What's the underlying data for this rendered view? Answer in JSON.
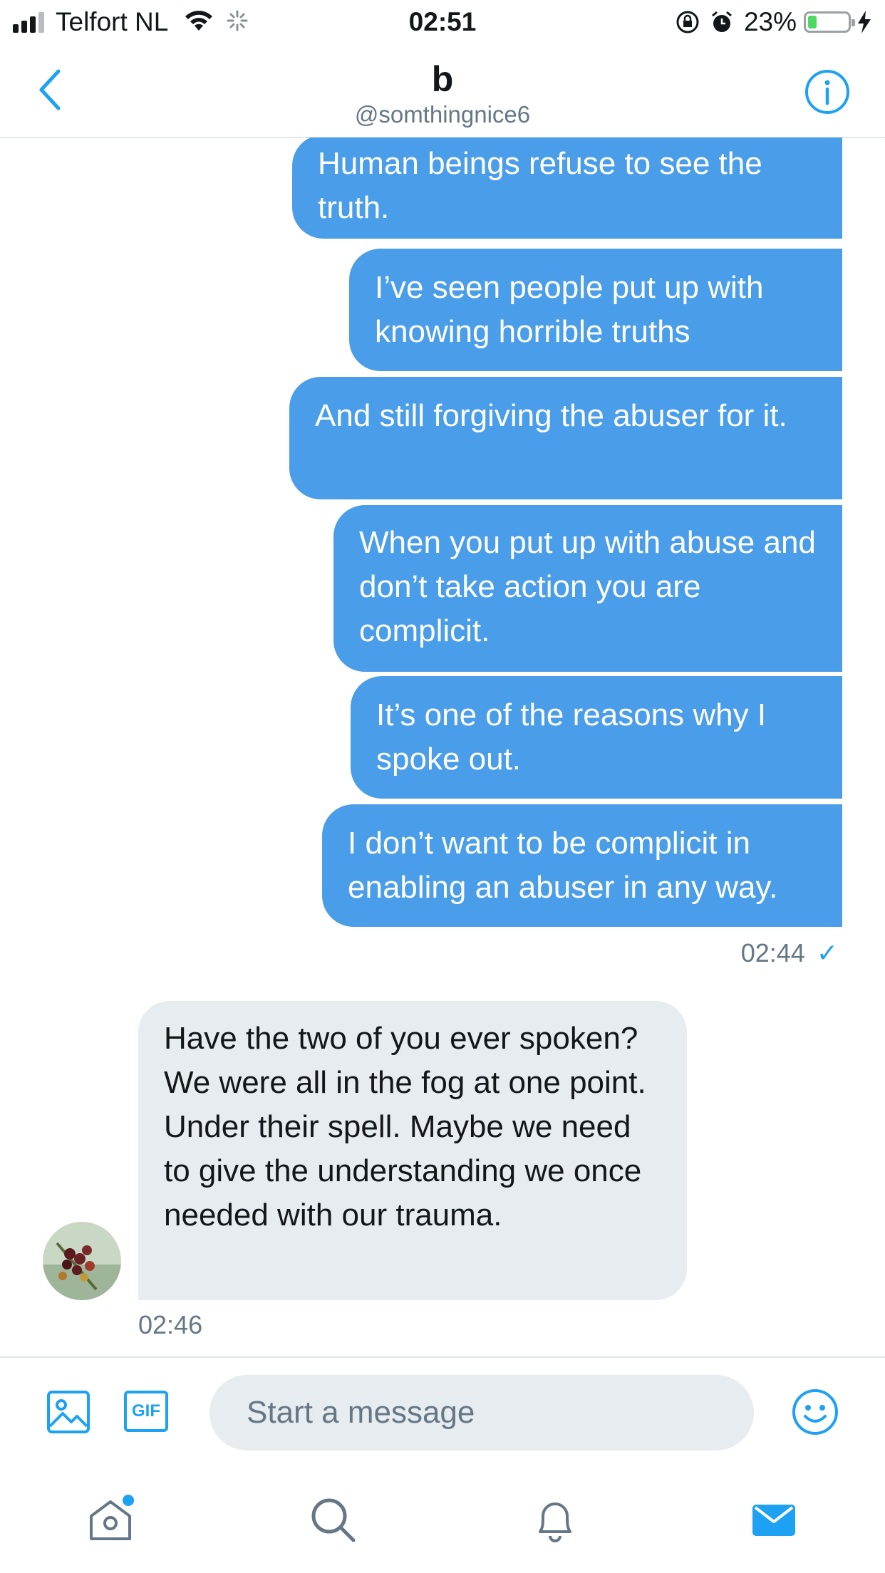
{
  "status_bar": {
    "carrier": "Telfort NL",
    "time": "02:51",
    "battery": "23%",
    "battery_level": 0.23
  },
  "header": {
    "title": "b",
    "handle": "@somthingnice6"
  },
  "messages": {
    "outgoing": [
      "Human beings refuse to see the truth.",
      "I’ve seen people put up with knowing horrible truths",
      "And still forgiving the abuser for it.",
      "When you put up with abuse and don’t take action you are complicit.",
      "It’s one of the reasons why I spoke out.",
      "I don’t want to be complicit in enabling an abuser in any way."
    ],
    "outgoing_time": "02:44",
    "outgoing_status": "✓",
    "incoming": [
      "Have the two of you ever spoken? We were all in the fog at one point. Under their spell. Maybe we need to give the understanding we once needed with our trauma."
    ],
    "incoming_time": "02:46"
  },
  "composer": {
    "placeholder": "Start a message",
    "gif_label": "GIF"
  },
  "colors": {
    "accent": "#1da1f2",
    "outgoing_bubble": "#4a9de8",
    "incoming_bubble": "#e6ecf0",
    "muted_text": "#657786"
  },
  "icons": [
    "back-chevron-icon",
    "info-icon",
    "image-icon",
    "gif-icon",
    "emoji-icon",
    "home-icon",
    "search-icon",
    "notifications-icon",
    "messages-icon"
  ]
}
